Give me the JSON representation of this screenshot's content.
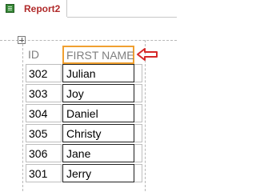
{
  "tab": {
    "title": "Report2",
    "icon": "report-icon"
  },
  "table": {
    "headers": {
      "id": "ID",
      "first_name": "FIRST NAME"
    },
    "rows": [
      {
        "id": "302",
        "first_name": "Julian"
      },
      {
        "id": "303",
        "first_name": "Joy"
      },
      {
        "id": "304",
        "first_name": "Daniel"
      },
      {
        "id": "305",
        "first_name": "Christy"
      },
      {
        "id": "306",
        "first_name": "Jane"
      },
      {
        "id": "301",
        "first_name": "Jerry"
      }
    ]
  },
  "annotation": {
    "icon": "red-arrow-left-icon",
    "color": "#d62828"
  },
  "colors": {
    "selection_border": "#f0a030",
    "tab_text": "#b02a2a"
  }
}
